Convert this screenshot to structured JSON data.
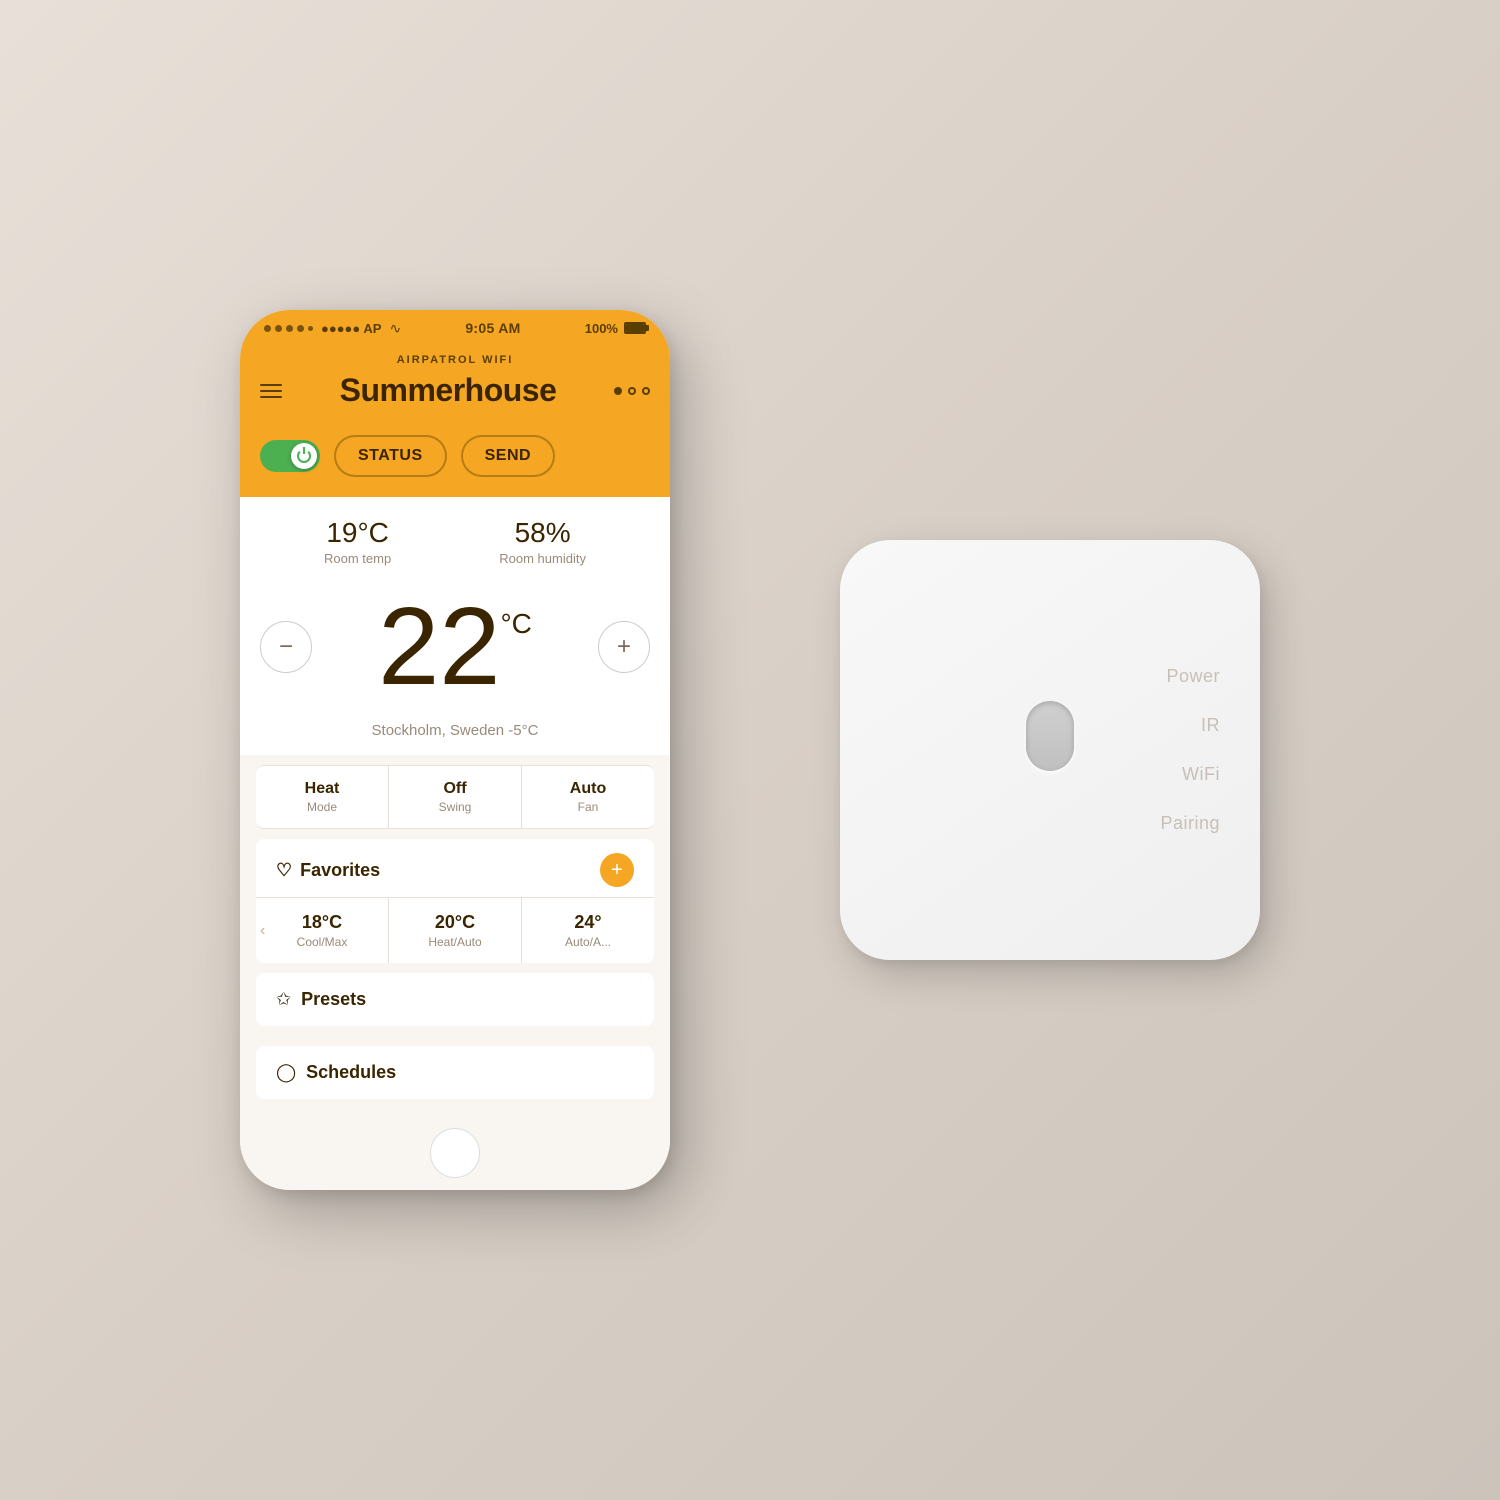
{
  "background": {
    "gradient_start": "#e8e0d8",
    "gradient_end": "#ccc4bb"
  },
  "status_bar": {
    "carrier": "●●●●● AP",
    "wifi": "WiFi",
    "time": "9:05 AM",
    "battery": "100%",
    "app_subtitle": "AIRPATROL WIFI"
  },
  "header": {
    "title": "Summerhouse",
    "hamburger_label": "menu",
    "dots": [
      "active",
      "inactive",
      "inactive"
    ]
  },
  "controls": {
    "toggle_state": "on",
    "status_label": "STATUS",
    "send_label": "SEND"
  },
  "room": {
    "temp_value": "19°C",
    "temp_label": "Room temp",
    "humidity_value": "58%",
    "humidity_label": "Room humidity"
  },
  "setpoint": {
    "value": "22",
    "unit": "°C",
    "decrement_label": "−",
    "increment_label": "+"
  },
  "location": {
    "text": "Stockholm, Sweden -5°C"
  },
  "modes": [
    {
      "main": "Heat",
      "sub": "Mode"
    },
    {
      "main": "Off",
      "sub": "Swing"
    },
    {
      "main": "Auto",
      "sub": "Fan"
    }
  ],
  "favorites": {
    "title": "Favorites",
    "add_label": "+",
    "items": [
      {
        "temp": "18°C",
        "mode": "Cool/Max"
      },
      {
        "temp": "20°C",
        "mode": "Heat/Auto"
      },
      {
        "temp": "24°",
        "mode": "Auto/A..."
      }
    ]
  },
  "presets": {
    "title": "Presets"
  },
  "schedules": {
    "title": "Schedules"
  },
  "hardware": {
    "labels": [
      "Power",
      "IR",
      "WiFi",
      "Pairing"
    ]
  }
}
